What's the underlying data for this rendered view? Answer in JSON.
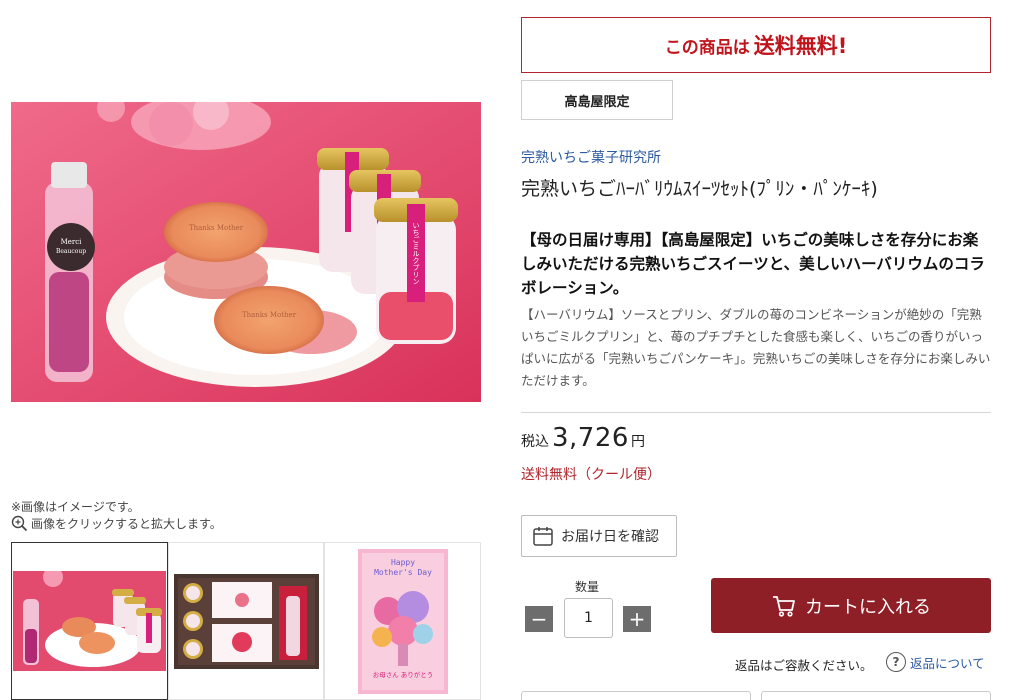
{
  "shipping_banner": {
    "prefix": "この商品は",
    "highlight": "送料無料!"
  },
  "limited_tag": "高島屋限定",
  "brand": "完熟いちご菓子研究所",
  "product_name": "完熟いちごﾊｰﾊﾞﾘｳﾑｽｲｰﾂｾｯﾄ(ﾌﾟﾘﾝ・ﾊﾟﾝｹｰｷ)",
  "catch_copy": "【母の日届け専用】【高島屋限定】いちごの美味しさを存分にお楽しみいただける完熟いちごスイーツと、美しいハーバリウムのコラボレーション。",
  "description": "【ハーバリウム】ソースとプリン、ダブルの苺のコンビネーションが絶妙の「完熟いちごミルクプリン」と、苺のプチプチとした食感も楽しく、いちごの香りがいっぱいに広がる「完熟いちごパンケーキ」。完熟いちごの美味しさを存分にお楽しみいただけます。",
  "price": {
    "tax_label": "税込",
    "amount": "3,726",
    "currency": "円"
  },
  "shipping_note": "送料無料（クール便）",
  "delivery_button": "お届け日を確認",
  "quantity": {
    "label": "数量",
    "value": "1",
    "minus": "−",
    "plus": "+"
  },
  "cart_button": "カートに入れる",
  "returns": {
    "text": "返品はご容赦ください。",
    "help_glyph": "?",
    "link": "返品について"
  },
  "image_notes": {
    "disclaimer": "※画像はイメージです。",
    "zoom_hint": "画像をクリックすると拡大します。"
  },
  "image_texts": {
    "herbarium_label_1": "Merci",
    "herbarium_label_2": "Beaucoup",
    "pancake_stamp": "Thanks Mother",
    "pudding_label": "いちごミルクプリン",
    "card_title_1": "Happy",
    "card_title_2": "Mother's Day",
    "card_message": "お母さん ありがとう"
  },
  "colors": {
    "brand_red": "#8e1f27",
    "alert_red": "#c0141c",
    "link_blue": "#2c5aa0"
  },
  "icons": [
    "zoom-icon",
    "calendar-icon",
    "cart-icon",
    "help-icon"
  ]
}
